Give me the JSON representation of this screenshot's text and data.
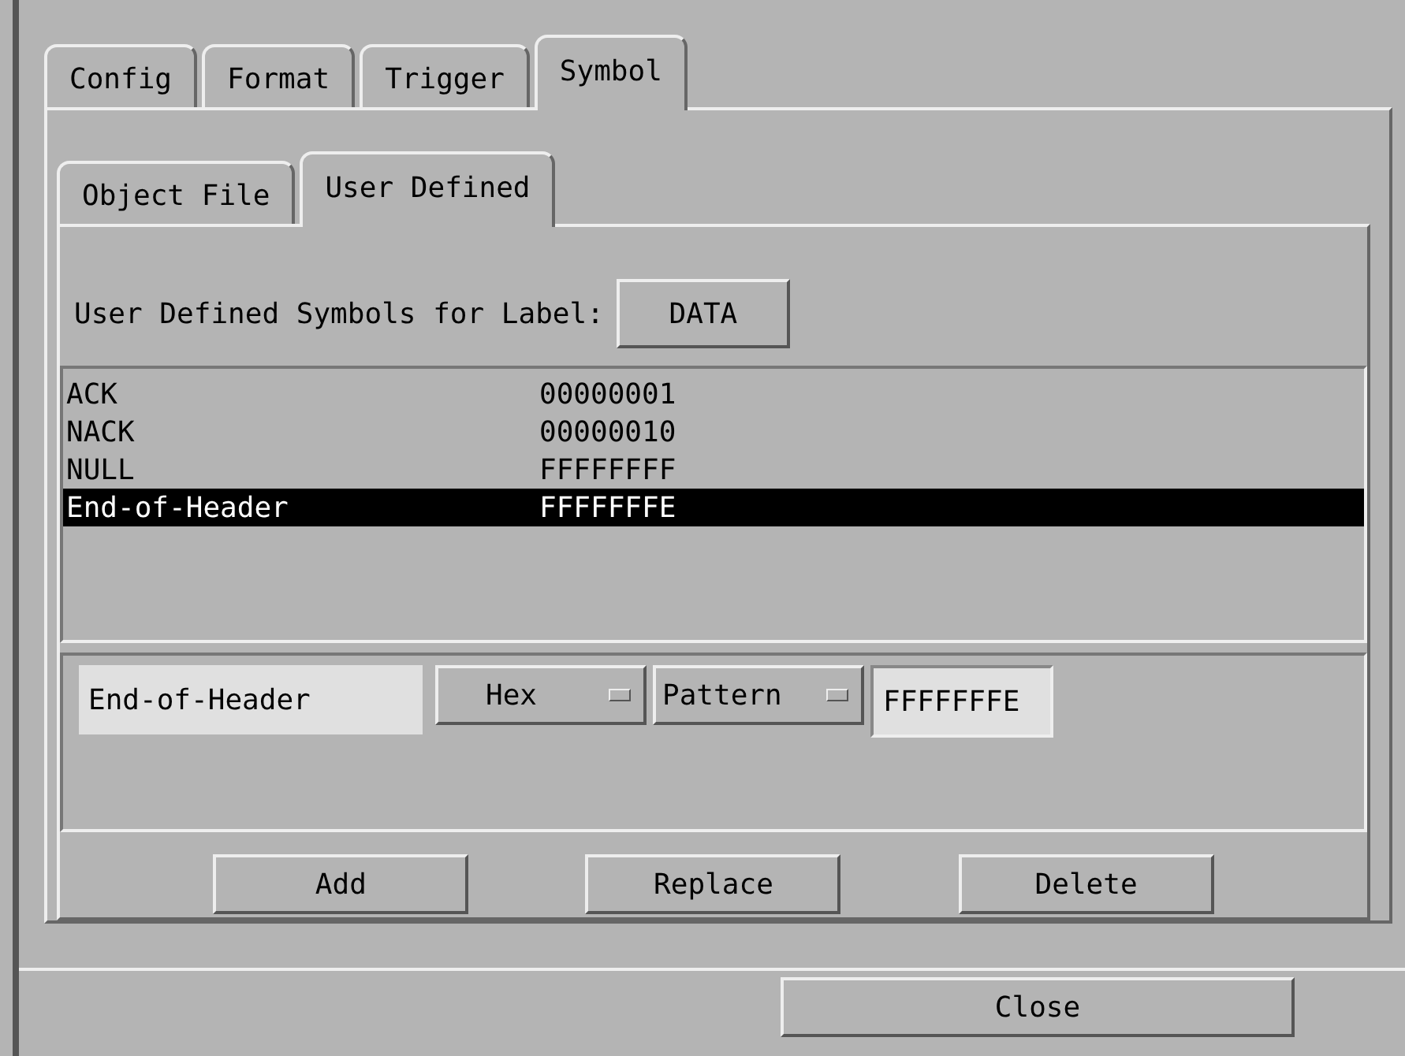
{
  "tabs": [
    {
      "label": "Config",
      "selected": false
    },
    {
      "label": "Format",
      "selected": false
    },
    {
      "label": "Trigger",
      "selected": false
    },
    {
      "label": "Symbol",
      "selected": true
    }
  ],
  "subtabs": [
    {
      "label": "Object File",
      "selected": false
    },
    {
      "label": "User Defined",
      "selected": true
    }
  ],
  "label_row": {
    "text": "User Defined Symbols for Label:",
    "button": "DATA"
  },
  "symbols": [
    {
      "name": "ACK",
      "value": "00000001",
      "selected": false
    },
    {
      "name": "NACK",
      "value": "00000010",
      "selected": false
    },
    {
      "name": "NULL",
      "value": "FFFFFFFF",
      "selected": false
    },
    {
      "name": "End-of-Header",
      "value": "FFFFFFFE",
      "selected": true
    }
  ],
  "editor": {
    "name": "End-of-Header",
    "base": "Hex",
    "type": "Pattern",
    "value": "FFFFFFFE"
  },
  "actions": [
    "Add",
    "Replace",
    "Delete"
  ],
  "close": "Close"
}
